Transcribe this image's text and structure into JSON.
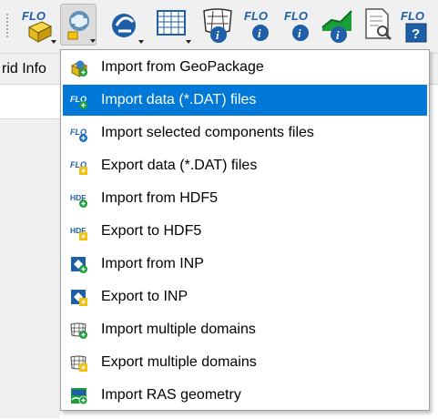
{
  "toolbar": {
    "buttons": [
      {
        "name": "flo2d-settings",
        "badge": "FLO"
      },
      {
        "name": "import-export",
        "badge": ""
      },
      {
        "name": "flo-editor",
        "badge": ""
      },
      {
        "name": "grid-table",
        "badge": ""
      },
      {
        "name": "grid-info",
        "badge": ""
      },
      {
        "name": "flo-info-1",
        "badge": "FLO"
      },
      {
        "name": "flo-info-2",
        "badge": "FLO"
      },
      {
        "name": "profile-info",
        "badge": ""
      },
      {
        "name": "report-viewer",
        "badge": ""
      },
      {
        "name": "flo-help",
        "badge": "FLO"
      }
    ]
  },
  "panel": {
    "tab_label": "rid Info"
  },
  "menu": {
    "items": [
      {
        "label": "Import from GeoPackage",
        "icon": "geopackage-import-icon"
      },
      {
        "label": "Import data (*.DAT) files",
        "icon": "flo-import-icon"
      },
      {
        "label": "Import selected components files",
        "icon": "flo-import-selected-icon"
      },
      {
        "label": "Export data (*.DAT) files",
        "icon": "flo-export-icon"
      },
      {
        "label": "Import from HDF5",
        "icon": "hdf-import-icon"
      },
      {
        "label": "Export to HDF5",
        "icon": "hdf-export-icon"
      },
      {
        "label": "Import from INP",
        "icon": "inp-import-icon"
      },
      {
        "label": "Export to INP",
        "icon": "inp-export-icon"
      },
      {
        "label": "Import multiple domains",
        "icon": "multi-domain-import-icon"
      },
      {
        "label": "Export multiple domains",
        "icon": "multi-domain-export-icon"
      },
      {
        "label": "Import RAS geometry",
        "icon": "ras-import-icon"
      }
    ],
    "highlighted_index": 1
  },
  "colors": {
    "highlight": "#0078d7",
    "flo_blue": "#1f5fa8",
    "plus_green": "#1a9e3a",
    "plus_yellow": "#f4c20d"
  }
}
